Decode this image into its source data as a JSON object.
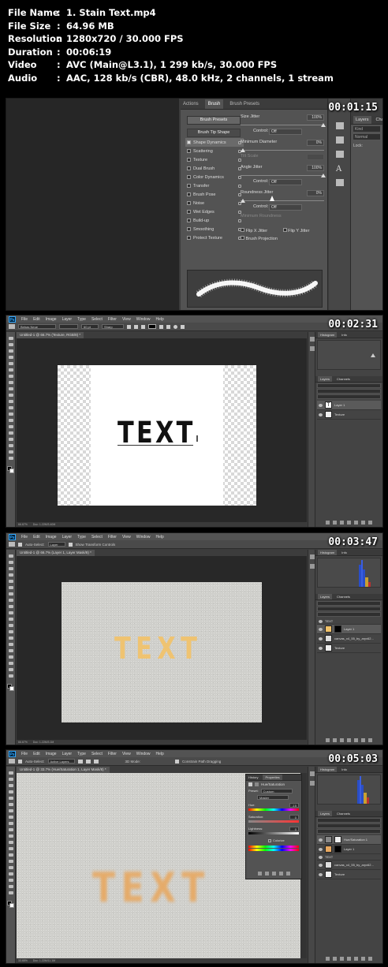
{
  "info": [
    {
      "key": "File Name",
      "value": "1. Stain Text.mp4"
    },
    {
      "key": "File Size",
      "value": "64.96 MB"
    },
    {
      "key": "Resolution",
      "value": "1280x720 / 30.000 FPS"
    },
    {
      "key": "Duration",
      "value": "00:06:19"
    },
    {
      "key": "Video",
      "value": "AVC (Main@L3.1), 1 299 kb/s, 30.000 FPS"
    },
    {
      "key": "Audio",
      "value": "AAC, 128 kb/s (CBR), 48.0 kHz, 2 channels, 1 stream"
    }
  ],
  "separator": ":",
  "frames": {
    "f1": {
      "timestamp": "00:01:15",
      "tabs": [
        "Actions",
        "Brush",
        "Brush Presets"
      ],
      "presets_button": "Brush Presets",
      "tip_shape": "Brush Tip Shape",
      "options": [
        "Shape Dynamics",
        "Scattering",
        "Texture",
        "Dual Brush",
        "Color Dynamics",
        "Transfer",
        "Brush Pose",
        "Noise",
        "Wet Edges",
        "Build-up",
        "Smoothing",
        "Protect Texture"
      ],
      "size_jitter": "Size Jitter",
      "size_jitter_val": "100%",
      "control": "Control:",
      "off": "Off",
      "min_diameter": "Minimum Diameter",
      "min_diameter_val": "0%",
      "tilt_scale": "Tilt Scale",
      "angle_jitter": "Angle Jitter",
      "angle_jitter_val": "100%",
      "roundness_jitter": "Roundness Jitter",
      "roundness_jitter_val": "0%",
      "min_roundness": "Minimum Roundness",
      "flip_x": "Flip X Jitter",
      "flip_y": "Flip Y Jitter",
      "brush_projection": "Brush Projection",
      "layers_tab": "Layers",
      "channels_tab": "Channe",
      "kind": "Kind",
      "normal": "Normal",
      "lock": "Lock:"
    },
    "f2": {
      "timestamp": "00:02:31",
      "menu": [
        "File",
        "Edit",
        "Image",
        "Layer",
        "Type",
        "Select",
        "Filter",
        "View",
        "Window",
        "Help"
      ],
      "font": "Bebas Neue",
      "size": "60 pt",
      "aa": "Sharp",
      "doc_tab": "Untitled-1 @ 66.7% (Texture, RGB/8) *",
      "canvas_text": "TEXT",
      "status": "66.67%",
      "doc_size": "Doc: 1.22M/3.40M",
      "histogram": "Histogram",
      "info_tab": "Info",
      "layers_tab": "Layers",
      "channels_tab": "Channels",
      "layers": [
        "Layer 1",
        "Texture"
      ]
    },
    "f3": {
      "timestamp": "00:03:47",
      "menu": [
        "File",
        "Edit",
        "Image",
        "Layer",
        "Type",
        "Select",
        "Filter",
        "View",
        "Window",
        "Help"
      ],
      "auto_select": "Auto-Select:",
      "layer_opt": "Layer",
      "transform": "Show Transform Controls",
      "doc_tab": "Untitled-1 @ 66.7% (Layer 1, Layer Mask/8) *",
      "canvas_text": "TEXT",
      "status": "66.67%",
      "doc_size": "Doc: 1.22M/3.1M",
      "histogram": "Histogram",
      "info_tab": "Info",
      "layers_tab": "Layers",
      "channels_tab": "Channels",
      "layers": [
        "TEXT",
        "Layer 1",
        "canvas_x4_55_by_aryx62...",
        "Texture"
      ]
    },
    "f4": {
      "timestamp": "00:05:03",
      "menu": [
        "File",
        "Edit",
        "Image",
        "Layer",
        "Type",
        "Select",
        "Filter",
        "View",
        "Window",
        "Help"
      ],
      "auto_select": "Auto-Select:",
      "active_layers": "Active Layers",
      "mode_3d": "3D Mode:",
      "constrain": "Constrain Path Dragging",
      "doc_tab": "Untitled-1 @ 33.7% (Hue/Saturation 1, Layer Mask/8) *",
      "canvas_text": "TEXT",
      "status": "33.68%",
      "doc_size": "Doc: 1.22M/11.1M",
      "props_tabs": [
        "History",
        "Properties"
      ],
      "props_title": "Hue/Saturation",
      "preset": "Preset:",
      "preset_val": "Custom",
      "master": "Master",
      "hue": "Hue:",
      "hue_val": "-15",
      "saturation": "Saturation:",
      "saturation_val": "0",
      "lightness": "Lightness:",
      "lightness_val": "0",
      "colorize": "Colorize",
      "histogram": "Histogram",
      "info_tab": "Info",
      "layers_tab": "Layers",
      "channels_tab": "Channels",
      "layers": [
        "Hue/Saturation 1",
        "Layer 1",
        "TEXT",
        "canvas_x4_55_by_aryx62...",
        "Texture"
      ]
    }
  },
  "colors": {
    "text_yellow": "#f2c36a",
    "text_blur": "#e8a860",
    "text_black": "#111111"
  }
}
